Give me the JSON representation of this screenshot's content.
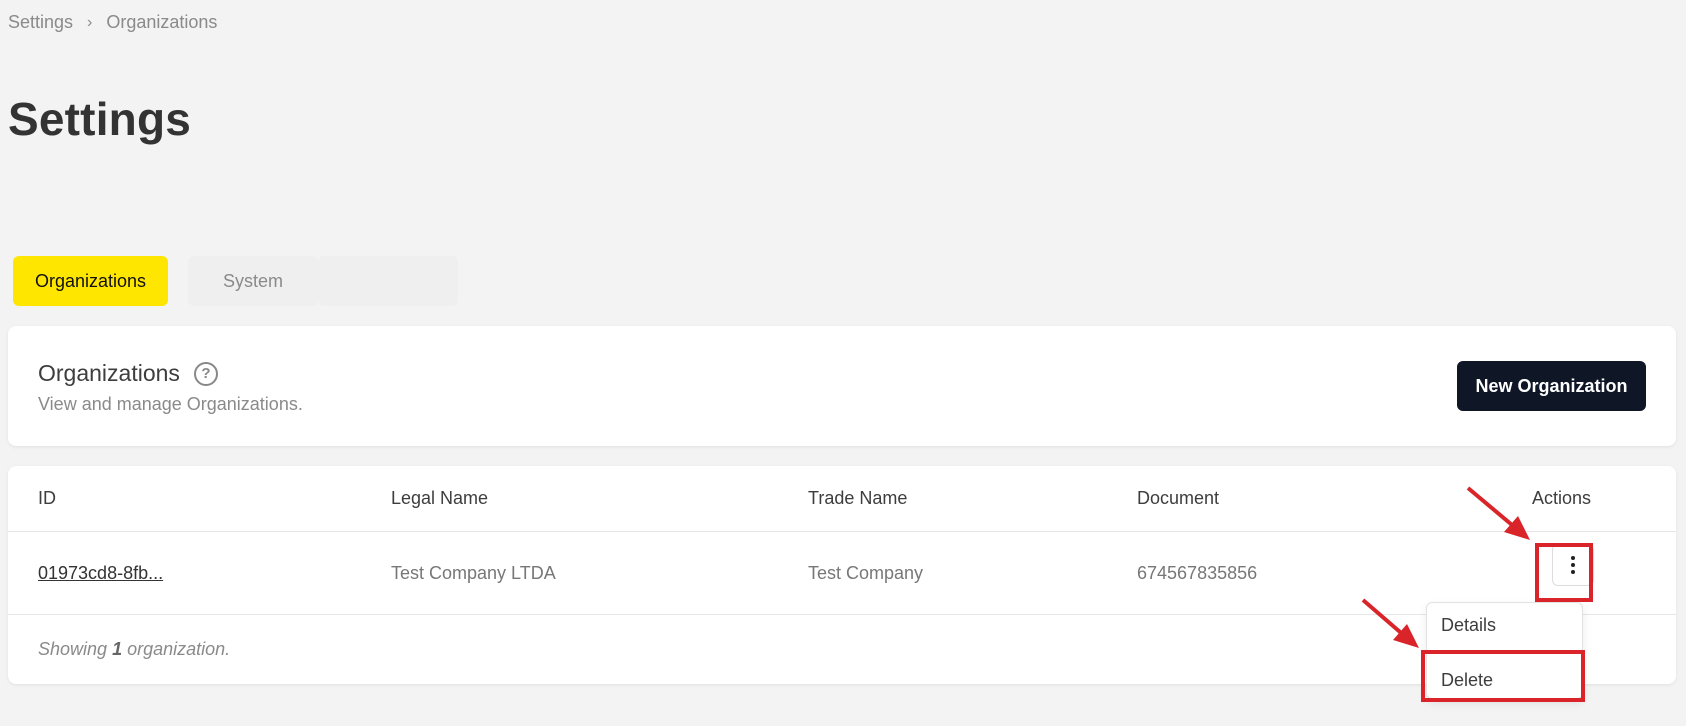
{
  "breadcrumb": {
    "items": [
      "Settings",
      "Organizations"
    ],
    "separator": "›"
  },
  "page_title": "Settings",
  "tabs": [
    {
      "label": "Organizations",
      "active": true
    },
    {
      "label": "System",
      "active": false
    }
  ],
  "header": {
    "title": "Organizations",
    "subtitle": "View and manage Organizations.",
    "new_button": "New Organization",
    "help_icon": "question-circle-icon"
  },
  "table": {
    "columns": [
      "ID",
      "Legal Name",
      "Trade Name",
      "Document",
      "Actions"
    ],
    "rows": [
      {
        "id": "01973cd8-8fb...",
        "legal_name": "Test Company LTDA",
        "trade_name": "Test Company",
        "document": "674567835856"
      }
    ],
    "footer": {
      "prefix": "Showing",
      "count": "1",
      "suffix": "organization."
    }
  },
  "actions_menu": {
    "items": [
      "Details",
      "Delete"
    ]
  },
  "colors": {
    "accent_tab": "#ffe600",
    "primary_button": "#0f1626",
    "annotation": "#d9252a"
  }
}
